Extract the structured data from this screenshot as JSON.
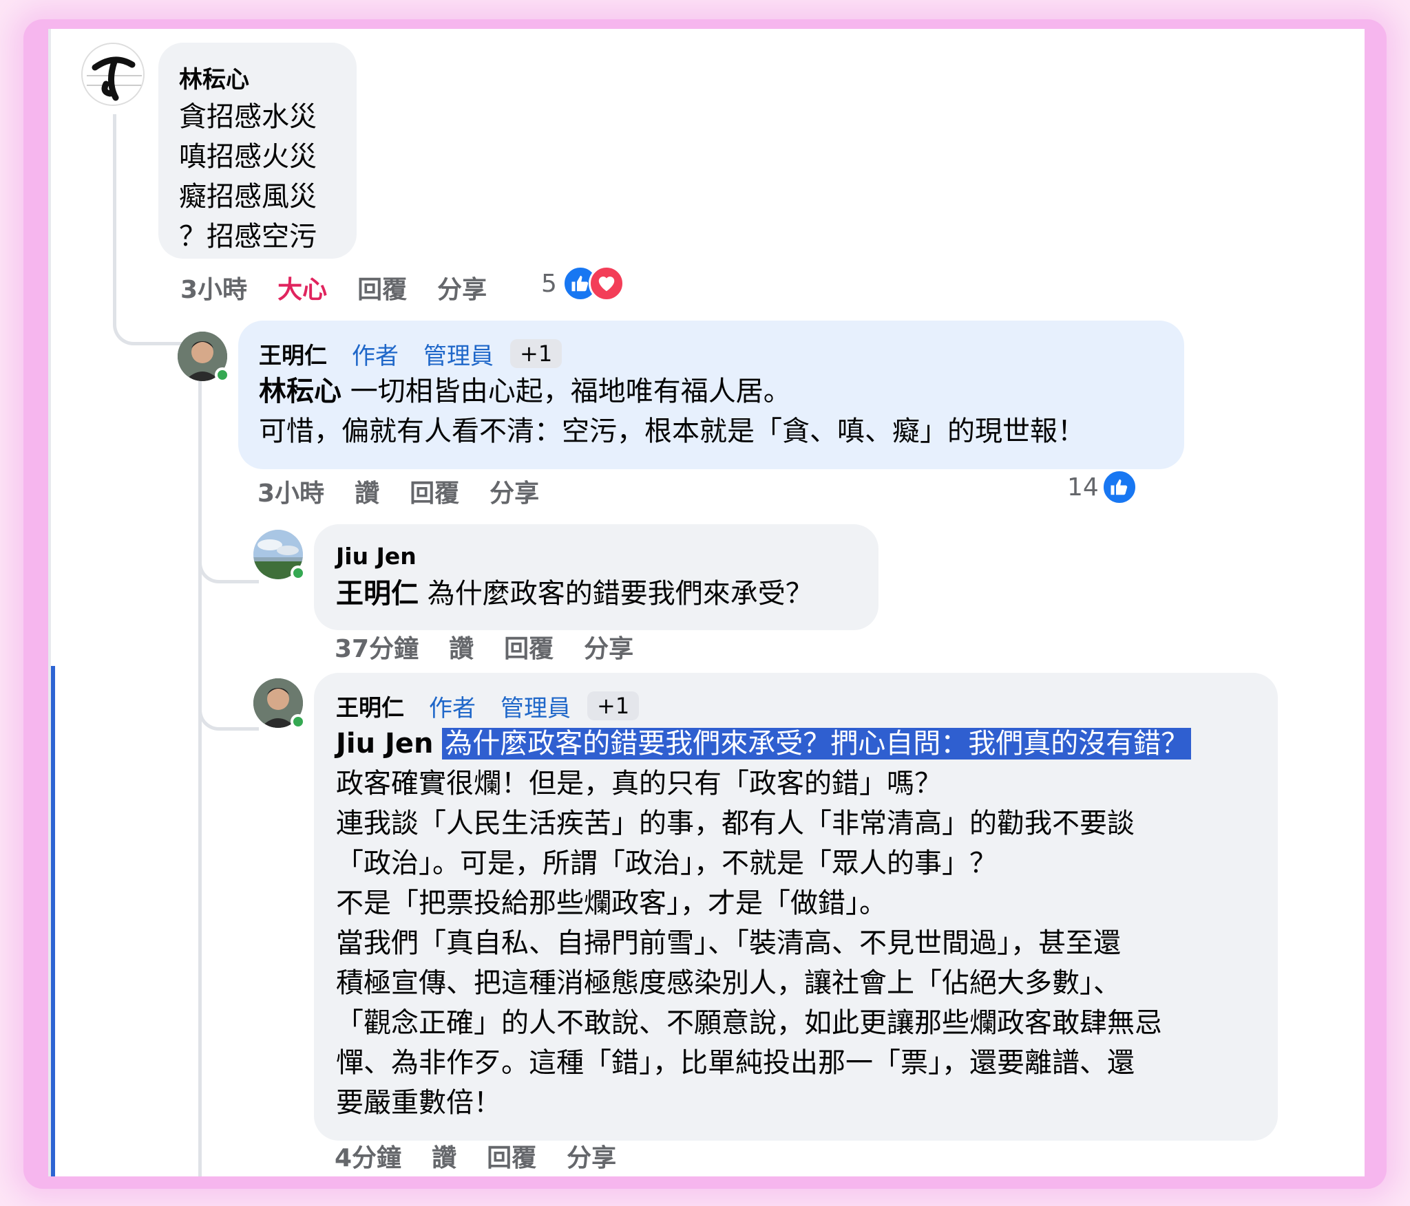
{
  "comments": [
    {
      "author": "林秐心",
      "lines": [
        "貪招感水災",
        "嗔招感火災",
        "癡招感風災",
        "？招感空污"
      ],
      "meta": {
        "time": "3小時",
        "reaction_label": "大心",
        "reply": "回覆",
        "share": "分享"
      },
      "reaction_count": "5",
      "reaction_icons": [
        "like-icon",
        "heart-icon"
      ]
    },
    {
      "author": "王明仁",
      "tags": [
        "作者",
        "管理員"
      ],
      "extra_tag": "+1",
      "mention": "林秐心",
      "lines": [
        "一切相皆由心起，福地唯有福人居。",
        "可惜，偏就有人看不清：空污，根本就是「貪、嗔、癡」的現世報！"
      ],
      "meta": {
        "time": "3小時",
        "like": "讚",
        "reply": "回覆",
        "share": "分享"
      },
      "reaction_count": "14",
      "reaction_icons": [
        "like-icon"
      ]
    },
    {
      "author": "Jiu Jen",
      "mention": "王明仁",
      "lines": [
        "為什麼政客的錯要我們來承受？"
      ],
      "meta": {
        "time": "37分鐘",
        "like": "讚",
        "reply": "回覆",
        "share": "分享"
      }
    },
    {
      "author": "王明仁",
      "tags": [
        "作者",
        "管理員"
      ],
      "extra_tag": "+1",
      "mention": "Jiu Jen",
      "selected_text": "為什麼政客的錯要我們來承受？捫心自問：我們真的沒有錯？",
      "lines": [
        "政客確實很爛！但是，真的只有「政客的錯」嗎？",
        "連我談「人民生活疾苦」的事，都有人「非常清高」的勸我不要談",
        "「政治」。可是，所謂「政治」，不就是「眾人的事」？",
        "不是「把票投給那些爛政客」，才是「做錯」。",
        "當我們「真自私、自掃門前雪」、「裝清高、不見世間過」，甚至還",
        "積極宣傳、把這種消極態度感染別人，讓社會上「佔絕大多數」、",
        "「觀念正確」的人不敢說、不願意說，如此更讓那些爛政客敢肆無忌",
        "憚、為非作歹。這種「錯」，比單純投出那一「票」，還要離譜、還",
        "要嚴重數倍！"
      ],
      "meta": {
        "time": "4分鐘",
        "like": "讚",
        "reply": "回覆",
        "share": "分享"
      }
    }
  ],
  "colors": {
    "link": "#1f67c9",
    "like": "#1877f2",
    "love": "#e0245e",
    "selection": "#2f5fd0",
    "online": "#35a852"
  }
}
